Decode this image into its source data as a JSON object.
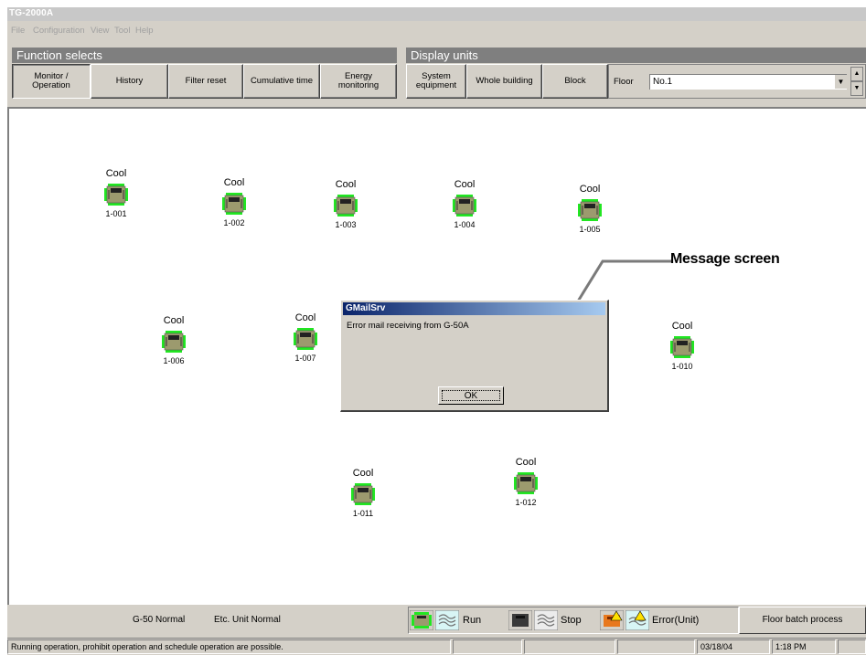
{
  "window": {
    "title": "TG-2000A"
  },
  "menu": [
    "File",
    "Configuration",
    "View",
    "Tool",
    "Help"
  ],
  "function_selects": {
    "header": "Function selects",
    "buttons": [
      "Monitor /\nOperation",
      "History",
      "Filter reset",
      "Cumulative time",
      "Energy\nmonitoring"
    ]
  },
  "display_units": {
    "header": "Display units",
    "buttons": [
      "System\nequipment",
      "Whole building",
      "Block"
    ],
    "floor_label": "Floor",
    "floor_value": "No.1"
  },
  "units": [
    {
      "mode": "Cool",
      "id": "1-001"
    },
    {
      "mode": "Cool",
      "id": "1-002"
    },
    {
      "mode": "Cool",
      "id": "1-003"
    },
    {
      "mode": "Cool",
      "id": "1-004"
    },
    {
      "mode": "Cool",
      "id": "1-005"
    },
    {
      "mode": "Cool",
      "id": "1-006"
    },
    {
      "mode": "Cool",
      "id": "1-007"
    },
    {
      "mode": "Cool",
      "id": "1-010"
    },
    {
      "mode": "Cool",
      "id": "1-011"
    },
    {
      "mode": "Cool",
      "id": "1-012"
    }
  ],
  "dialog": {
    "title": "GMailSrv",
    "message": "Error mail receiving from G-50A",
    "ok_label": "OK"
  },
  "callout": "Message screen",
  "status": {
    "g50": "G-50  Normal",
    "etc_unit": "Etc. Unit Normal",
    "legend_run": "Run",
    "legend_stop": "Stop",
    "legend_error": "Error(Unit)",
    "floor_batch": "Floor batch process",
    "statusbar_message": "Running operation, prohibit operation and schedule operation are possible.",
    "date": "03/18/04",
    "time": "1:18 PM"
  },
  "colors": {
    "run_green": "#22e622",
    "unit_body": "#9c9a6e",
    "header_gray": "#7f7f7f",
    "dialog_title": "#0a246a"
  }
}
